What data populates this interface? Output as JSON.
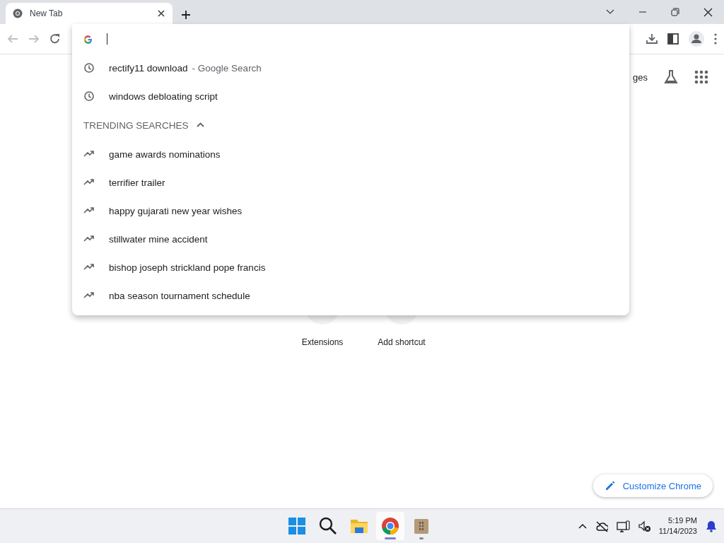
{
  "tab": {
    "title": "New Tab",
    "selected": true
  },
  "suggestions": [
    {
      "kind": "history",
      "text": "rectify11 download",
      "suffix": "- Google Search"
    },
    {
      "kind": "history",
      "text": "windows debloating script"
    },
    {
      "kind": "header",
      "text": "TRENDING SEARCHES",
      "expanded": true
    },
    {
      "kind": "trending",
      "text": "game awards nominations"
    },
    {
      "kind": "trending",
      "text": "terrifier trailer"
    },
    {
      "kind": "trending",
      "text": "happy gujarati new year wishes"
    },
    {
      "kind": "trending",
      "text": "stillwater mine accident"
    },
    {
      "kind": "trending",
      "text": "bishop joseph strickland pope francis"
    },
    {
      "kind": "trending",
      "text": "nba season tournament schedule"
    }
  ],
  "header_link": "ges",
  "shortcuts": [
    {
      "label": "Extensions"
    },
    {
      "label": "Add shortcut"
    }
  ],
  "customize_button": "Customize Chrome",
  "taskbar": {
    "apps": [
      {
        "kind": "start",
        "active": false
      },
      {
        "kind": "search",
        "active": false
      },
      {
        "kind": "files",
        "active": false
      },
      {
        "kind": "chrome",
        "active": true
      },
      {
        "kind": "archive",
        "active": false
      }
    ],
    "time": "5:19 PM",
    "date": "11/14/2023"
  }
}
